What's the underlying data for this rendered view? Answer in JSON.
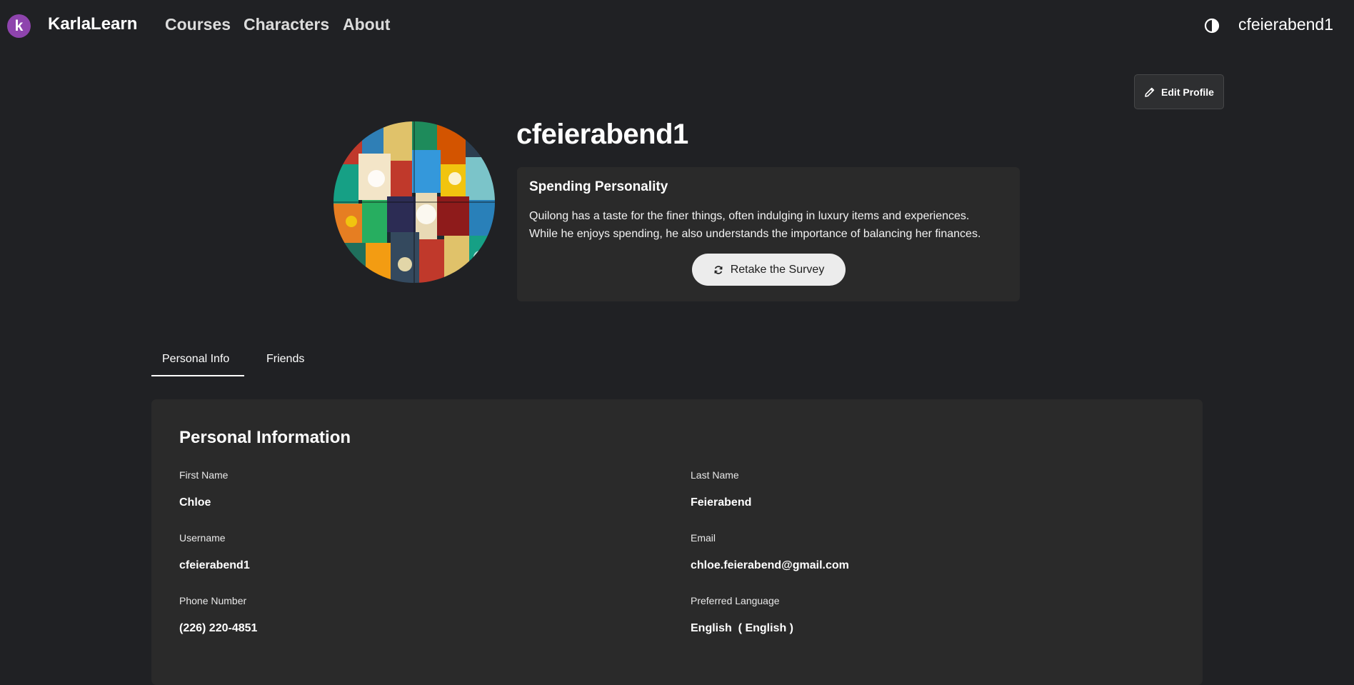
{
  "nav": {
    "logo_letter": "k",
    "brand": "KarlaLearn",
    "links": [
      "Courses",
      "Characters",
      "About"
    ],
    "theme_icon": "contrast-icon",
    "user": "cfeierabend1"
  },
  "profile": {
    "edit_label": "Edit Profile",
    "username": "cfeierabend1",
    "avatar": "colorful-mosaic-artwork"
  },
  "personality": {
    "heading": "Spending Personality",
    "line1": "Quilong has a taste for the finer things, often indulging in luxury items and experiences.",
    "line2": "While he enjoys spending, he also understands the importance of balancing her finances.",
    "retake_label": "Retake the Survey"
  },
  "tabs": [
    {
      "label": "Personal Info",
      "active": true
    },
    {
      "label": "Friends",
      "active": false
    }
  ],
  "info": {
    "heading": "Personal Information",
    "fields": [
      {
        "label": "First Name",
        "value": "Chloe"
      },
      {
        "label": "Last Name",
        "value": "Feierabend"
      },
      {
        "label": "Username",
        "value": "cfeierabend1"
      },
      {
        "label": "Email",
        "value": "chloe.feierabend@gmail.com"
      },
      {
        "label": "Phone Number",
        "value": "(226) 220-4851"
      },
      {
        "label": "Preferred Language",
        "value": "English  ( English )"
      }
    ]
  },
  "colors": {
    "background": "#202124",
    "card": "#2a2a2a",
    "logo": "#8e44ad"
  }
}
